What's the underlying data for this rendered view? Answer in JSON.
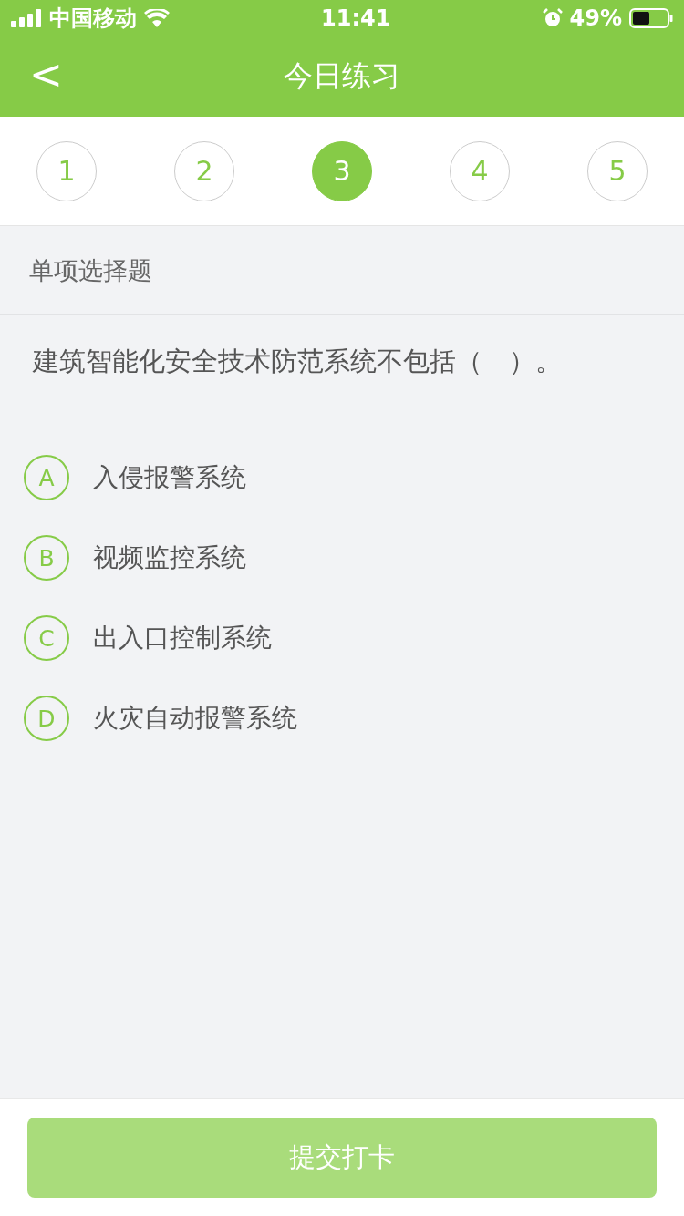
{
  "status_bar": {
    "carrier": "中国移动",
    "time": "11:41",
    "battery": "49%"
  },
  "nav": {
    "back": "<",
    "title": "今日练习"
  },
  "steps": [
    {
      "label": "1",
      "selected": false
    },
    {
      "label": "2",
      "selected": false
    },
    {
      "label": "3",
      "selected": true
    },
    {
      "label": "4",
      "selected": false
    },
    {
      "label": "5",
      "selected": false
    }
  ],
  "question_type": "单项选择题",
  "question": "建筑智能化安全技术防范系统不包括（　）。",
  "options": [
    {
      "letter": "A",
      "text": "入侵报警系统",
      "selected": false
    },
    {
      "letter": "B",
      "text": "视频监控系统",
      "selected": false
    },
    {
      "letter": "C",
      "text": "出入口控制系统",
      "selected": false
    },
    {
      "letter": "D",
      "text": "火灾自动报警系统",
      "selected": false
    }
  ],
  "submit": {
    "label": "提交打卡",
    "disabled": true
  }
}
